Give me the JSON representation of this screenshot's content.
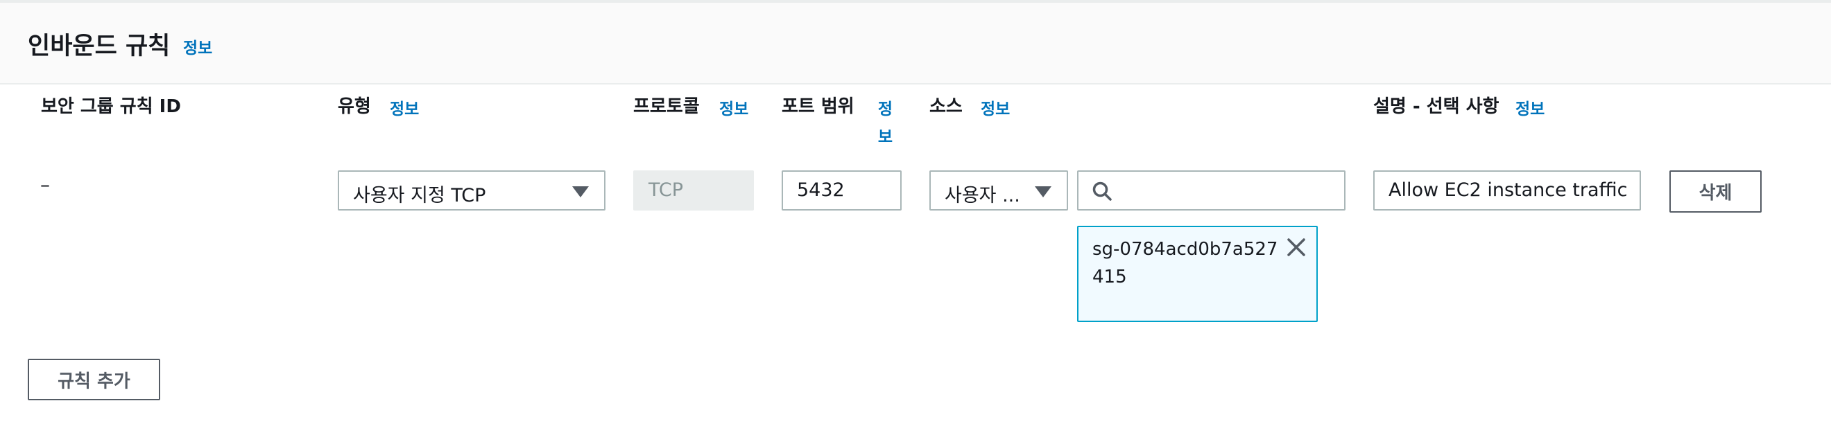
{
  "section": {
    "title": "인바운드 규칙",
    "info_label": "정보"
  },
  "columns": {
    "rule_id": "보안 그룹 규칙 ID",
    "type": "유형",
    "protocol": "프로토콜",
    "port_range": "포트 범위",
    "source": "소스",
    "description": "설명 - 선택 사항",
    "info_label": "정보"
  },
  "rule": {
    "id": "–",
    "type": "사용자 지정 TCP",
    "protocol": "TCP",
    "port_range": "5432",
    "source_type": "사용자 ...",
    "source_search_value": "",
    "source_token": "sg-0784acd0b7a527415",
    "description": "Allow EC2 instance traffic",
    "delete_label": "삭제"
  },
  "add_rule_label": "규칙 추가",
  "icons": {
    "search": "search-icon",
    "dropdown": "caret-down-icon",
    "close": "close-icon"
  },
  "colors": {
    "link": "#0073bb",
    "token_border": "#00a1c9",
    "token_bg": "#f1faff"
  }
}
